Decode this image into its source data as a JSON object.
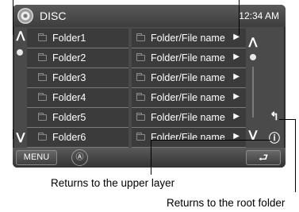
{
  "status_bar": {
    "source": "DISC",
    "clock": "12:34 AM",
    "icon": "disc-icon"
  },
  "folders": {
    "left": [
      "Folder1",
      "Folder2",
      "Folder3",
      "Folder4",
      "Folder5",
      "Folder6"
    ],
    "right": [
      "Folder/File name",
      "Folder/File name",
      "Folder/File name",
      "Folder/File name",
      "Folder/File name",
      "Folder/File name"
    ]
  },
  "glyphs": {
    "up": "ᐱ",
    "down": "ᐯ",
    "play": "▶",
    "root": "↰",
    "upper": "ⓘ",
    "eject": "Ⓐ",
    "return": "⮐"
  },
  "bottom_bar": {
    "menu_label": "MENU"
  },
  "callouts": {
    "upper_layer": "Returns to the upper layer",
    "root_folder": "Returns to the root folder"
  }
}
